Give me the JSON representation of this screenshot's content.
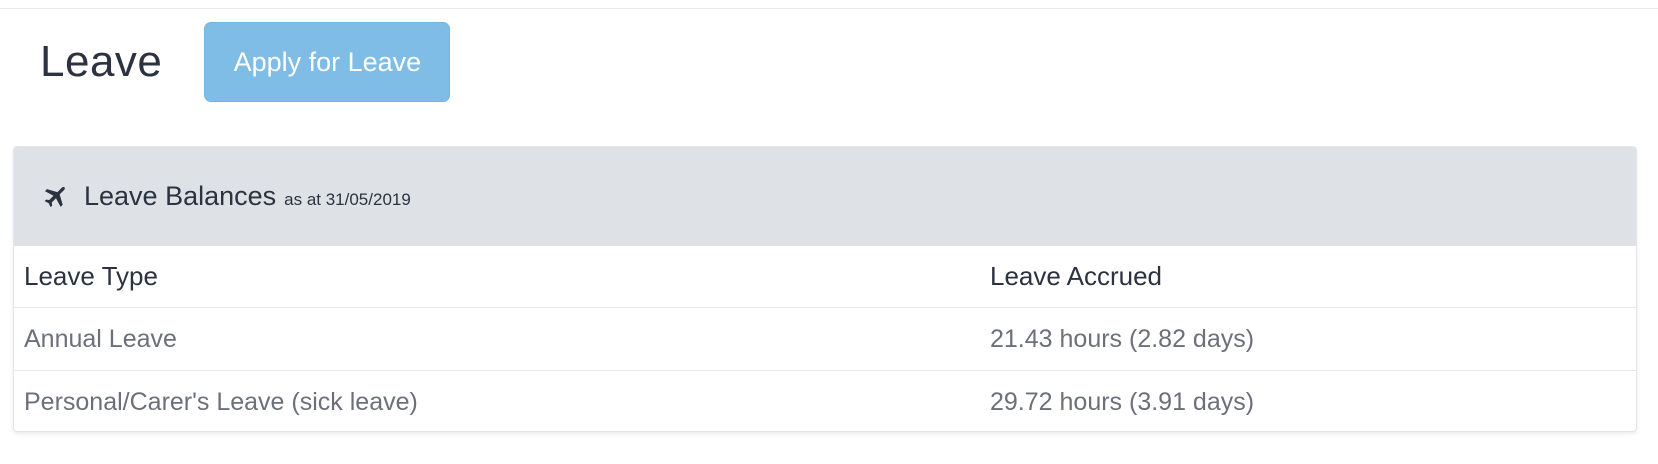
{
  "page": {
    "title": "Leave",
    "apply_button_label": "Apply for Leave"
  },
  "panel": {
    "icon": "plane-icon",
    "title": "Leave Balances",
    "subtitle": "as at 31/05/2019"
  },
  "table": {
    "headers": [
      "Leave Type",
      "Leave Accrued"
    ],
    "rows": [
      [
        "Annual Leave",
        "21.43 hours (2.82 days)"
      ],
      [
        "Personal/Carer's Leave (sick leave)",
        "29.72 hours (3.91 days)"
      ]
    ]
  },
  "colors": {
    "button_bg": "#7fbde6",
    "panel_heading_bg": "#dee2e6",
    "text_dark": "#2b3240",
    "text_muted": "#6b7079"
  }
}
